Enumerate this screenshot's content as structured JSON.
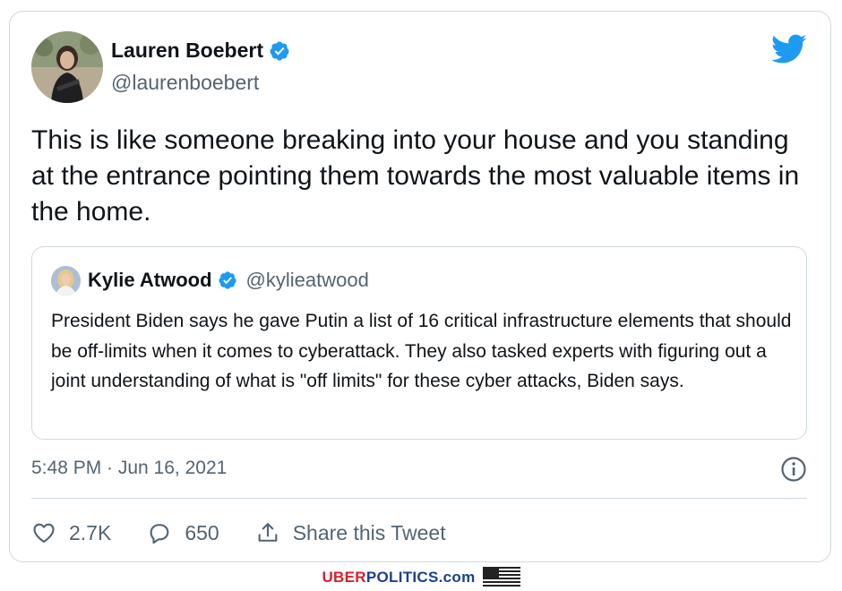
{
  "tweet": {
    "author_name": "Lauren Boebert",
    "author_handle": "@laurenboebert",
    "text": "This is like someone breaking into your house and you standing at the entrance pointing them towards the most valuable items in the home.",
    "timestamp": "5:48 PM · Jun 16, 2021"
  },
  "quoted": {
    "author_name": "Kylie Atwood",
    "author_handle": "@kylieatwood",
    "text": "President Biden says he gave Putin a list of 16 critical infrastructure elements that should be off-limits when it comes to cyberattack. They also tasked experts with figuring out a joint understanding of what is \"off limits\" for these cyber attacks, Biden says."
  },
  "actions": {
    "like_count": "2.7K",
    "reply_count": "650",
    "share_label": "Share this Tweet"
  },
  "footer": {
    "brand_part1": "UBER",
    "brand_part2": "POLITICS.com"
  },
  "icons": {
    "twitter": "twitter-bird-icon",
    "verified": "verified-badge-icon",
    "info": "info-icon",
    "like": "heart-icon",
    "reply": "speech-bubble-icon",
    "share": "share-arrow-icon",
    "flag": "us-flag-icon"
  },
  "colors": {
    "twitter_blue": "#1d9bf0",
    "text_primary": "#0f1419",
    "text_secondary": "#536471",
    "border": "#cfd9de",
    "brand_red": "#d8202b",
    "brand_blue": "#1c3f94"
  }
}
